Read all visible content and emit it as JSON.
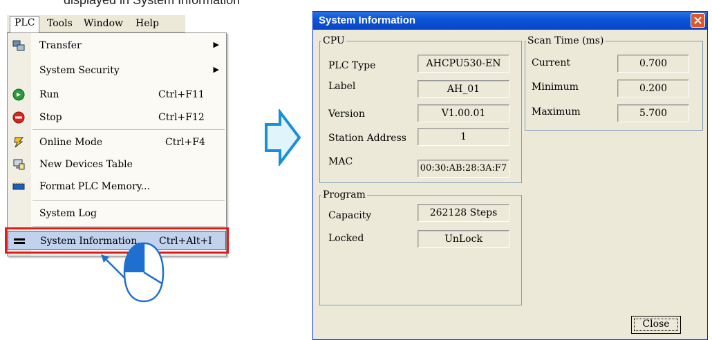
{
  "caption": "displayed in System Information",
  "menubar": {
    "items": [
      "PLC",
      "Tools",
      "Window",
      "Help"
    ]
  },
  "menu": {
    "items": [
      {
        "label": "Transfer",
        "shortcut": "",
        "icon": "transfer-icon",
        "submenu": true
      },
      {
        "label": "System Security",
        "shortcut": "",
        "icon": "",
        "submenu": true
      },
      {
        "label": "Run",
        "shortcut": "Ctrl+F11",
        "icon": "run-icon",
        "submenu": false
      },
      {
        "label": "Stop",
        "shortcut": "Ctrl+F12",
        "icon": "stop-icon",
        "submenu": false
      },
      {
        "label": "Online Mode",
        "shortcut": "Ctrl+F4",
        "icon": "online-mode-icon",
        "submenu": false
      },
      {
        "label": "New Devices Table",
        "shortcut": "",
        "icon": "devices-table-icon",
        "submenu": false
      },
      {
        "label": "Format PLC Memory...",
        "shortcut": "",
        "icon": "format-memory-icon",
        "submenu": false
      },
      {
        "label": "System Log",
        "shortcut": "",
        "icon": "",
        "submenu": false
      },
      {
        "label": "System Information...",
        "shortcut": "Ctrl+Alt+I",
        "icon": "system-info-icon",
        "submenu": false,
        "selected": true
      }
    ]
  },
  "dialog": {
    "title": "System Information",
    "cpu": {
      "legend": "CPU",
      "fields": [
        {
          "label": "PLC Type",
          "value": "AHCPU530-EN"
        },
        {
          "label": "Label",
          "value": "AH_01"
        },
        {
          "label": "Version",
          "value": "V1.00.01"
        },
        {
          "label": "Station Address",
          "value": "1"
        },
        {
          "label": "MAC",
          "value": "00:30:AB:28:3A:F7"
        }
      ]
    },
    "program": {
      "legend": "Program",
      "fields": [
        {
          "label": "Capacity",
          "value": "262128 Steps"
        },
        {
          "label": "Locked",
          "value": "UnLock"
        }
      ]
    },
    "scan_time": {
      "legend": "Scan Time (ms)",
      "fields": [
        {
          "label": "Current",
          "value": "0.700"
        },
        {
          "label": "Minimum",
          "value": "0.200"
        },
        {
          "label": "Maximum",
          "value": "5.700"
        }
      ]
    },
    "close_label": "Close"
  },
  "colors": {
    "title_bar": "#0a56d8",
    "highlight_frame": "#e31b1b",
    "selection": "#c1d2ee",
    "arrow_fill": "#dff4fb",
    "arrow_stroke": "#1a8fd6",
    "mouse_stroke": "#1e6fd0"
  }
}
